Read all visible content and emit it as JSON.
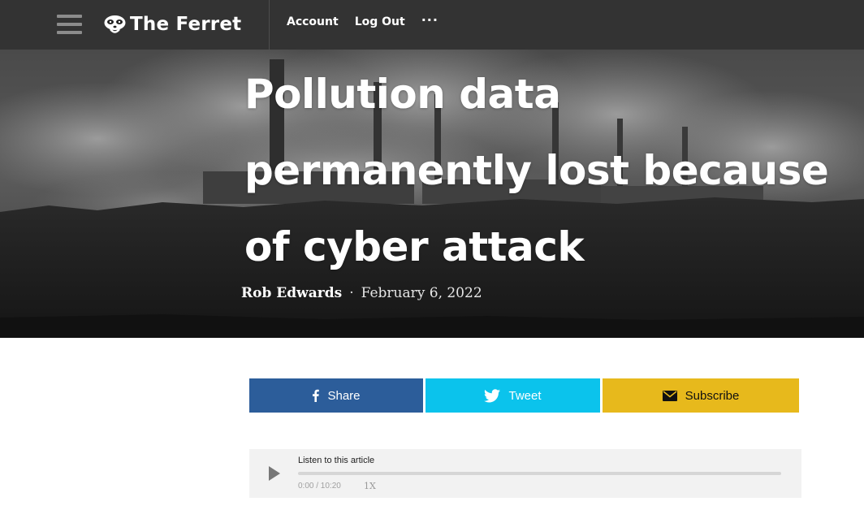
{
  "nav": {
    "brand": "The Ferret",
    "links": [
      "Account",
      "Log Out"
    ],
    "more": "···"
  },
  "article": {
    "headline": "Pollution data permanently lost because of cyber attack",
    "author": "Rob Edwards",
    "separator": "·",
    "date": "February 6, 2022"
  },
  "share": {
    "facebook": {
      "label": "Share",
      "icon": "facebook-icon",
      "color": "#2c5d9a"
    },
    "twitter": {
      "label": "Tweet",
      "icon": "twitter-icon",
      "color": "#0bc3ec"
    },
    "subscribe": {
      "label": "Subscribe",
      "icon": "envelope-icon",
      "color": "#e7b91c"
    }
  },
  "player": {
    "label": "Listen to this article",
    "time": "0:00 / 10:20",
    "speed": "1X",
    "progress": 0
  }
}
